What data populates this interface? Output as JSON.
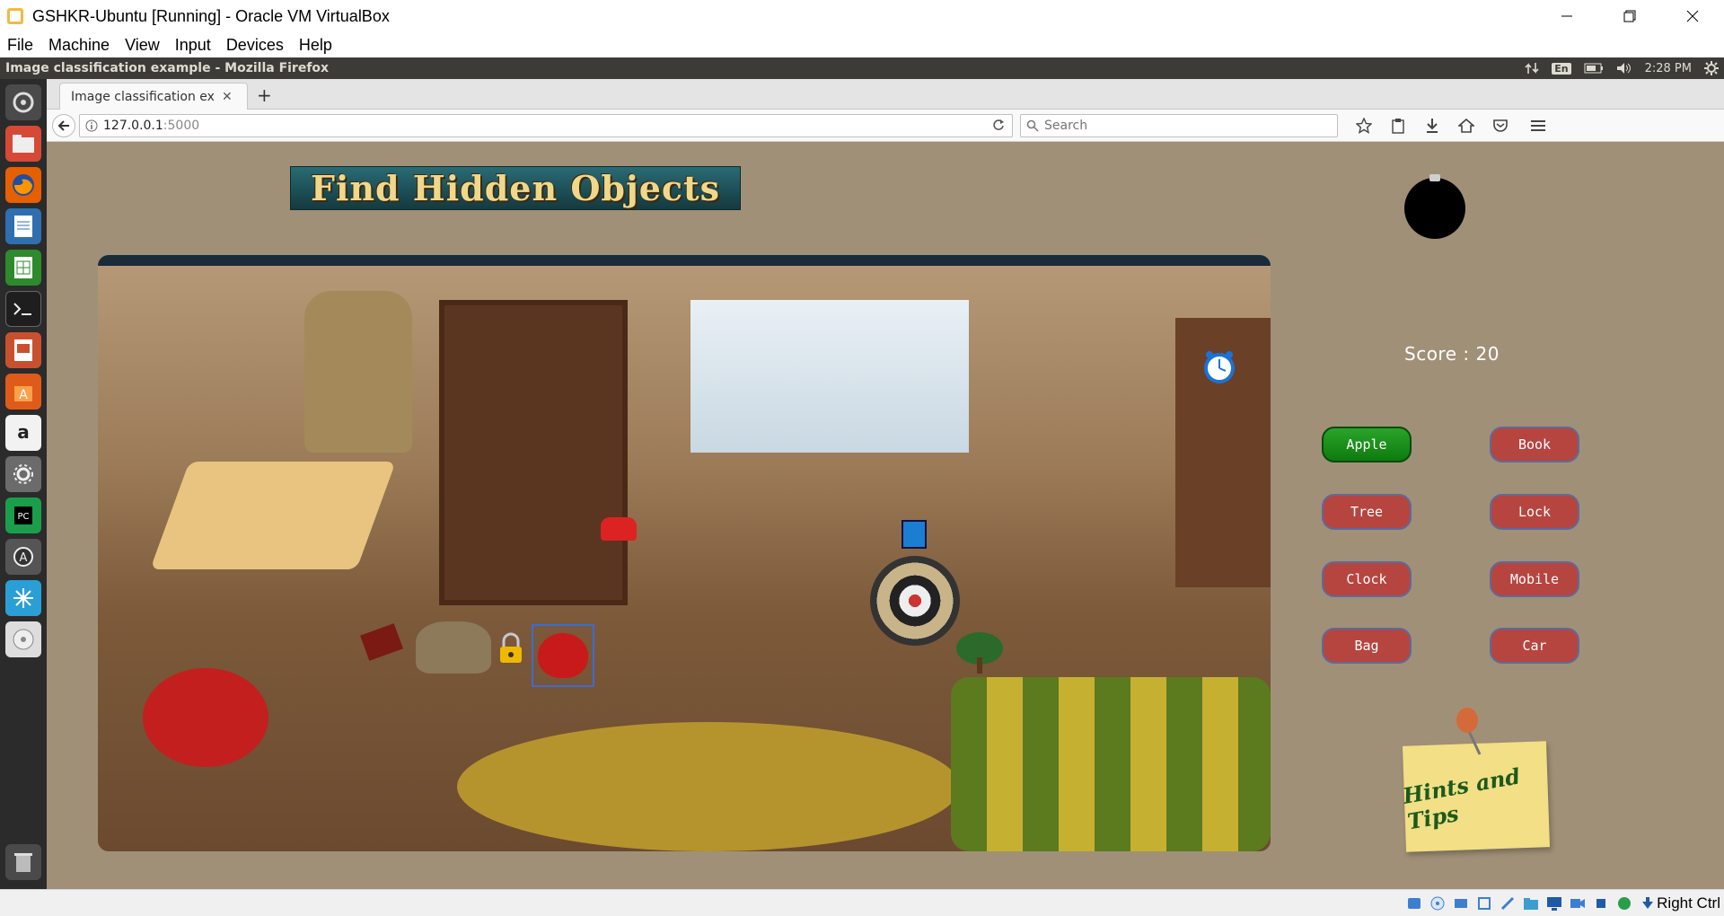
{
  "window": {
    "title": "GSHKR-Ubuntu [Running] - Oracle VM VirtualBox",
    "menu": [
      "File",
      "Machine",
      "View",
      "Input",
      "Devices",
      "Help"
    ]
  },
  "ubuntu_panel": {
    "title": "Image classification example - Mozilla Firefox",
    "keyboard": "En",
    "time": "2:28 PM"
  },
  "browser": {
    "tab_label": "Image classification ex...",
    "url_host": "127.0.0.1",
    "url_port": ":5000",
    "search_placeholder": "Search"
  },
  "game": {
    "banner_title": "Find Hidden Objects",
    "score_text": "Score : 20",
    "objects": [
      {
        "label": "Apple",
        "found": true
      },
      {
        "label": "Book",
        "found": false
      },
      {
        "label": "Tree",
        "found": false
      },
      {
        "label": "Lock",
        "found": false
      },
      {
        "label": "Clock",
        "found": false
      },
      {
        "label": "Mobile",
        "found": false
      },
      {
        "label": "Bag",
        "found": false
      },
      {
        "label": "Car",
        "found": false
      }
    ],
    "hints_label": "Hints and Tips"
  },
  "vbox_status": {
    "host_key": "Right Ctrl"
  },
  "colors": {
    "page_bg": "#a09078",
    "button_bg": "#b64540",
    "button_found_bg": "#1a8f1a",
    "ubuntu_panel_bg": "#3c3b37"
  }
}
